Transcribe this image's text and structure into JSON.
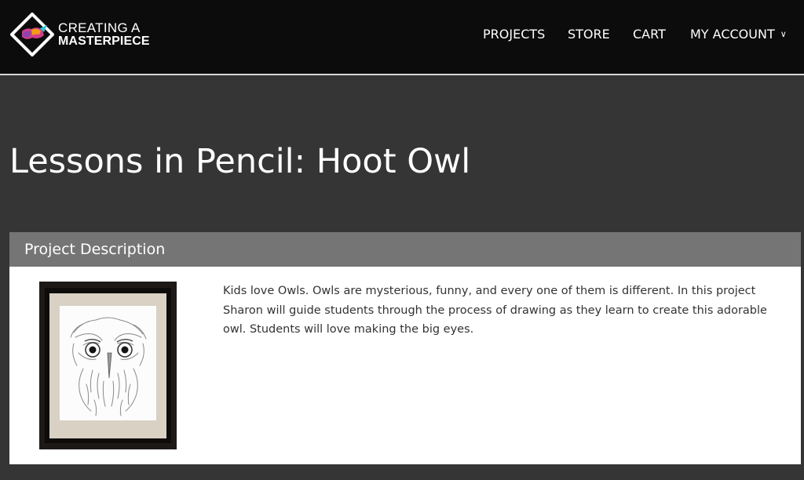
{
  "brand": {
    "line1": "CREATING A",
    "line2": "MASTERPIECE"
  },
  "nav": {
    "projects": "PROJECTS",
    "store": "STORE",
    "cart": "CART",
    "account": "MY ACCOUNT",
    "account_icon": "chevron-down-icon"
  },
  "page": {
    "title": "Lessons in Pencil: Hoot Owl"
  },
  "project": {
    "section_title": "Project Description",
    "image_subject": "framed pencil drawing of an owl",
    "description": "Kids love Owls. Owls are mysterious, funny, and every one of them is different. In this project Sharon will guide students through the process of drawing as they learn to create this adorable owl. Students will love making the big eyes."
  },
  "colors": {
    "header_bg": "#0c0c0c",
    "page_bg": "#353535",
    "card_header_bg": "#757575",
    "text_light": "#ffffff",
    "text_dark": "#333333"
  }
}
